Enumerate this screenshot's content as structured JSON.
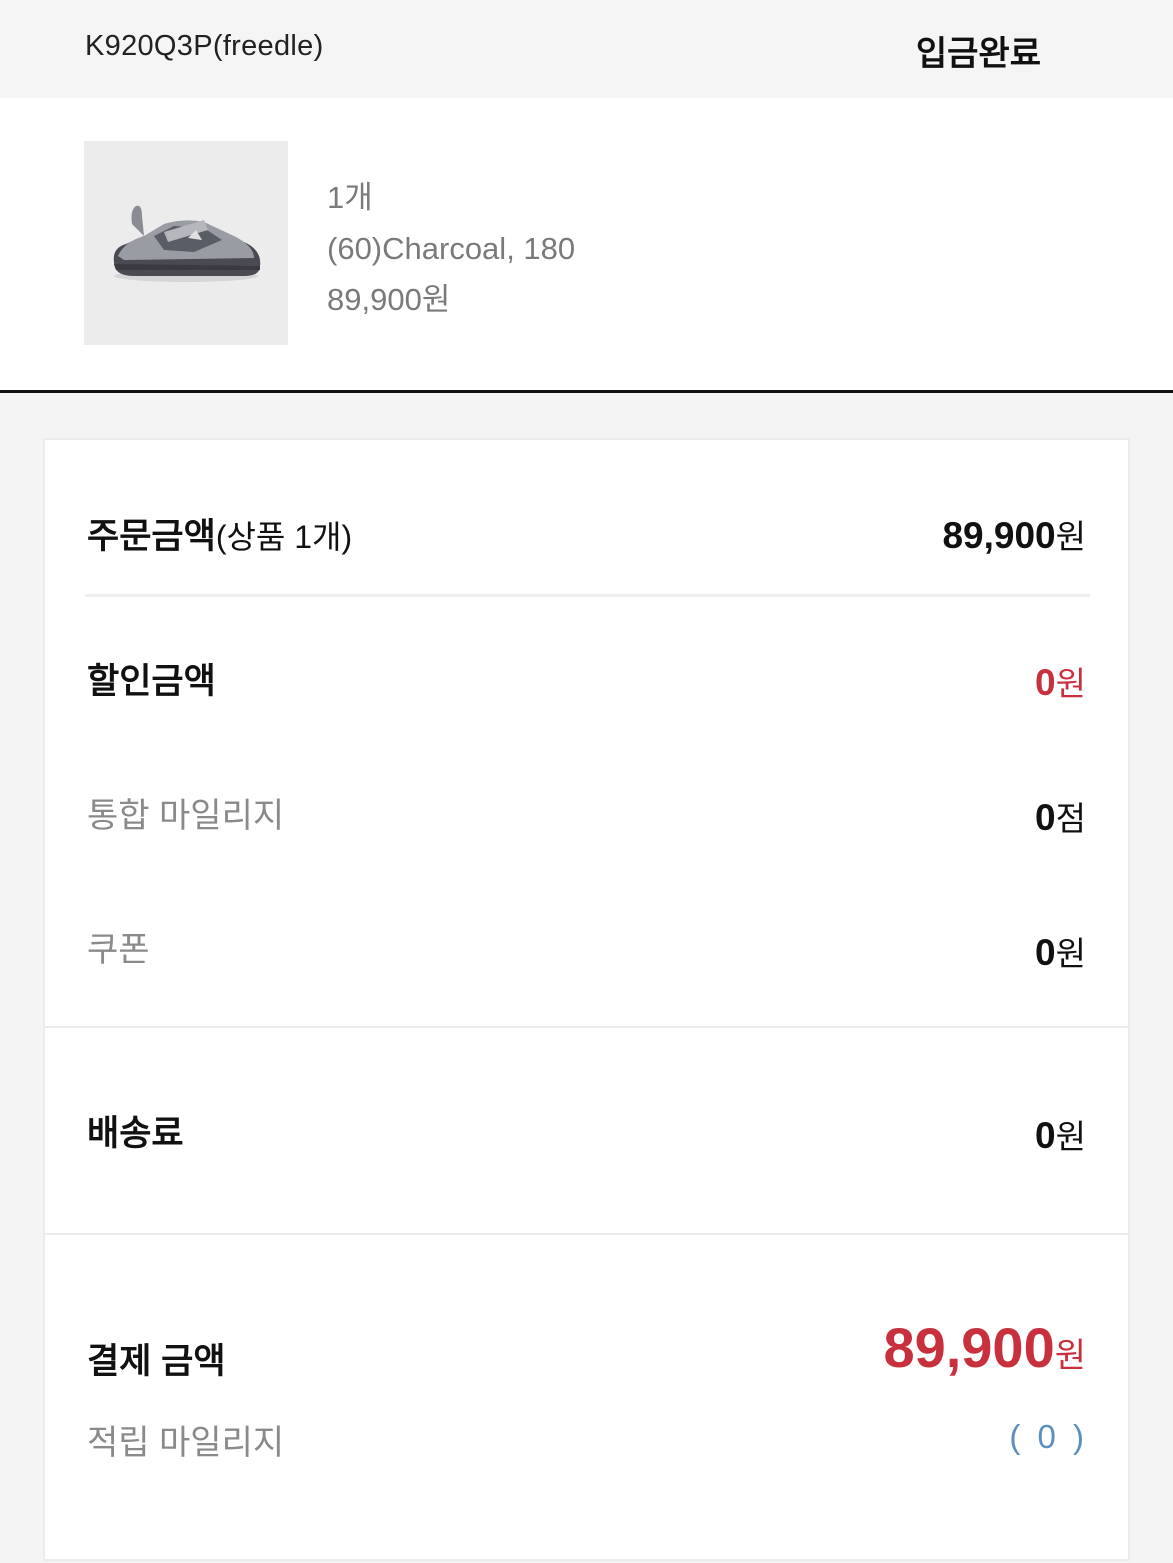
{
  "header": {
    "order_code": "K920Q3P(freedle)",
    "status": "입금완료"
  },
  "product": {
    "image_icon": "sandal-shoe-image",
    "quantity": "1개",
    "option": "(60)Charcoal, 180",
    "price": "89,900원"
  },
  "summary": {
    "order_amount_label": "주문금액",
    "order_amount_sub": "(상품 1개)",
    "order_amount_value": "89,900",
    "order_amount_unit": "원",
    "discount_label": "할인금액",
    "discount_value": "0",
    "discount_unit": "원",
    "mileage_label": "통합 마일리지",
    "mileage_value": "0",
    "mileage_unit": "점",
    "coupon_label": "쿠폰",
    "coupon_value": "0",
    "coupon_unit": "원"
  },
  "shipping": {
    "label": "배송료",
    "value": "0",
    "unit": "원"
  },
  "total": {
    "label": "결제 금액",
    "value": "89,900",
    "unit": "원",
    "points_label": "적립 마일리지",
    "points_value": "( 0 )"
  },
  "colors": {
    "accent_red": "#c8303d",
    "points_blue": "#5a8fbf",
    "muted_gray": "#8a8a8a"
  }
}
